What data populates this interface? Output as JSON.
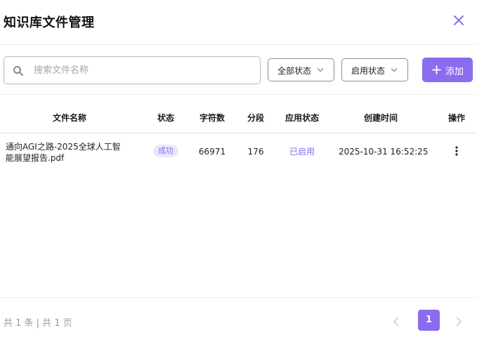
{
  "dialog": {
    "title": "知识库文件管理"
  },
  "toolbar": {
    "search_placeholder": "搜索文件名称",
    "search_value": "",
    "status_filter": "全部状态",
    "enabled_filter": "启用状态",
    "add_label": "添加"
  },
  "table": {
    "columns": [
      "文件名称",
      "状态",
      "字符数",
      "分段",
      "应用状态",
      "创建时间",
      "操作"
    ],
    "rows": [
      {
        "file_name_line1": "通向AGI之路-2025全球人工智",
        "file_name_line2": "能展望报告.pdf",
        "status": "成功",
        "chars": "66971",
        "segments": "176",
        "apply_status": "已启用",
        "created_at": "2025-10-31 16:52:25"
      }
    ]
  },
  "footer": {
    "total_text": "共 1 条 | 共 1 页",
    "current_page": "1"
  },
  "colors": {
    "accent": "#8b6cf0",
    "badge_bg": "#ece7fc",
    "border": "#b9b9b9"
  },
  "icons": {
    "close": "close-icon",
    "search": "search-icon",
    "chevron": "chevron-down-icon",
    "add": "plus-icon",
    "more": "more-vertical-icon",
    "prev": "chevron-left-icon",
    "next": "chevron-right-icon"
  }
}
